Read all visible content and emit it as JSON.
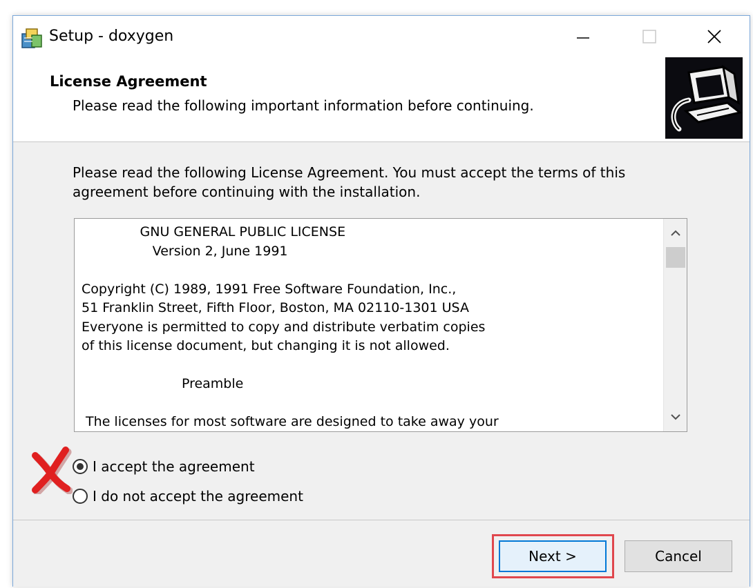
{
  "window": {
    "title": "Setup - doxygen"
  },
  "header": {
    "title": "License Agreement",
    "subtitle": "Please read the following important information before continuing."
  },
  "content": {
    "instructions": "Please read the following License Agreement. You must accept the terms of this agreement before continuing with the installation.",
    "license_text": "              GNU GENERAL PUBLIC LICENSE\n                 Version 2, June 1991\n\nCopyright (C) 1989, 1991 Free Software Foundation, Inc.,\n51 Franklin Street, Fifth Floor, Boston, MA 02110-1301 USA\nEveryone is permitted to copy and distribute verbatim copies\nof this license document, but changing it is not allowed.\n\n                        Preamble\n\n The licenses for most software are designed to take away your",
    "scroll_position": 0
  },
  "options": {
    "accept_label": "I accept the agreement",
    "decline_label": "I do not accept the agreement",
    "selected": "accept"
  },
  "buttons": {
    "next_label": "Next >",
    "cancel_label": "Cancel"
  },
  "colors": {
    "highlight": "#e0474d",
    "annotation_x": "#e02020",
    "focus_border": "#0078d7"
  },
  "icons": {
    "app": "setup-package-icon",
    "header_image": "computer-install-image",
    "annotation": "red-x-mark-icon"
  }
}
